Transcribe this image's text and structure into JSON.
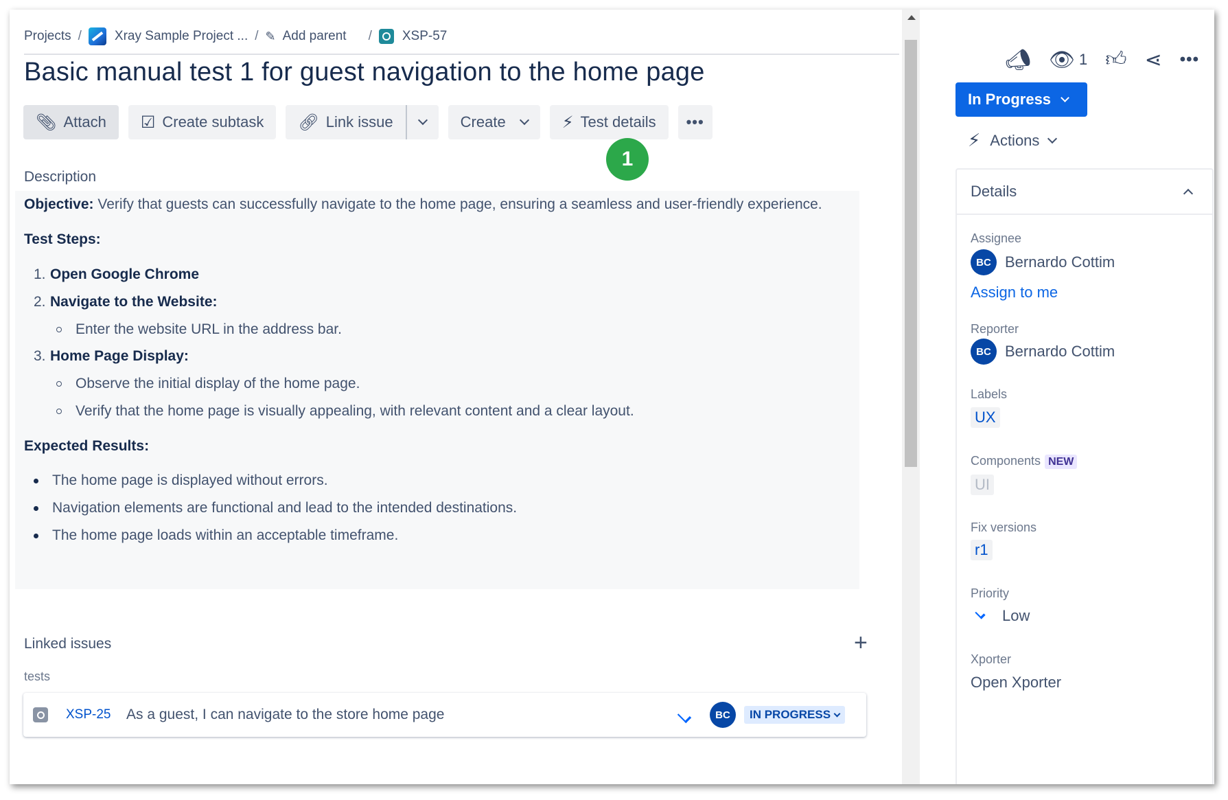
{
  "breadcrumb": {
    "projects": "Projects",
    "project_name": "Xray Sample Project ...",
    "add_parent": "Add parent",
    "issue_key": "XSP-57"
  },
  "issue": {
    "title": "Basic manual test 1 for guest navigation to the home page"
  },
  "toolbar": {
    "attach": "Attach",
    "create_subtask": "Create subtask",
    "link_issue": "Link issue",
    "create": "Create",
    "test_details": "Test details"
  },
  "marker": {
    "number": "1",
    "color": "#2ca84a"
  },
  "description": {
    "label": "Description",
    "objective_label": "Objective:",
    "objective_text": " Verify that guests can successfully navigate to the home page, ensuring a seamless and user-friendly experience.",
    "steps_heading": "Test Steps:",
    "step1_num": "1.",
    "step1": "Open Google Chrome",
    "step2_num": "2.",
    "step2": "Navigate to the Website:",
    "step2_sub1": "Enter the website URL in the address bar.",
    "step3_num": "3.",
    "step3": "Home Page Display:",
    "step3_sub1": "Observe the initial display of the home page.",
    "step3_sub2": "Verify that the home page is visually appealing, with relevant content and a clear layout.",
    "expected_heading": "Expected Results:",
    "expected": [
      "The home page is displayed without errors.",
      "Navigation elements are functional and lead to the intended destinations.",
      "The home page loads within an acceptable timeframe."
    ]
  },
  "linked_issues": {
    "label": "Linked issues",
    "relation": "tests",
    "items": [
      {
        "key": "XSP-25",
        "summary": "As a guest, I can navigate to the store home page",
        "assignee_initials": "BC",
        "status": "IN PROGRESS"
      }
    ]
  },
  "sidebar": {
    "watch_count": "1",
    "status": "In Progress",
    "status_color": "#0c66e4",
    "actions": "Actions",
    "details_title": "Details",
    "assignee_label": "Assignee",
    "assignee_initials": "BC",
    "assignee_name": "Bernardo Cottim",
    "assign_to_me": "Assign to me",
    "reporter_label": "Reporter",
    "reporter_initials": "BC",
    "reporter_name": "Bernardo Cottim",
    "labels_label": "Labels",
    "label_value": "UX",
    "components_label": "Components",
    "components_badge": "NEW",
    "component_value": "UI",
    "fix_versions_label": "Fix versions",
    "fix_version_value": "r1",
    "priority_label": "Priority",
    "priority_value": "Low",
    "xporter_label": "Xporter",
    "xporter_value": "Open Xporter"
  }
}
